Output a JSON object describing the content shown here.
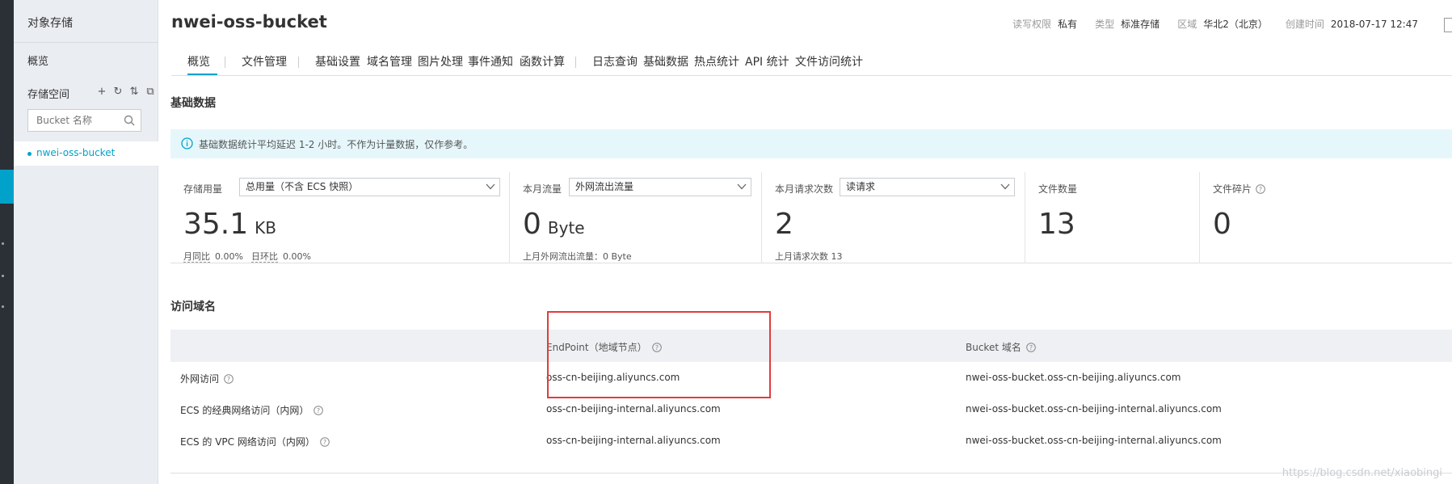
{
  "sidebar": {
    "title": "对象存储",
    "overview": "概览",
    "space_label": "存储空间",
    "tools": [
      "+",
      "↻",
      "⇅",
      "⧉"
    ],
    "search_placeholder": "Bucket 名称",
    "bucket_name": "nwei-oss-bucket"
  },
  "header": {
    "title": "nwei-oss-bucket",
    "meta": [
      {
        "k": "读写权限",
        "v": "私有"
      },
      {
        "k": "类型",
        "v": "标准存储"
      },
      {
        "k": "区域",
        "v": "华北2（北京）"
      },
      {
        "k": "创建时间",
        "v": "2018-07-17 12:47"
      }
    ]
  },
  "tabs": [
    "概览",
    "文件管理",
    "基础设置",
    "域名管理",
    "图片处理",
    "事件通知",
    "函数计算",
    "日志查询",
    "基础数据",
    "热点统计",
    "API 统计",
    "文件访问统计"
  ],
  "basic_data": {
    "title": "基础数据",
    "notice": "基础数据统计平均延迟 1-2 小时。不作为计量数据，仅作参考。",
    "stats": [
      {
        "label": "存储用量",
        "select": "总用量（不含 ECS 快照）",
        "value": "35.1",
        "unit": "KB",
        "sub1_k": "月同比",
        "sub1_v": "0.00%",
        "sub2_k": "日环比",
        "sub2_v": "0.00%"
      },
      {
        "label": "本月流量",
        "select": "外网流出流量",
        "value": "0",
        "unit": "Byte",
        "sub": "上月外网流出流量：0 Byte"
      },
      {
        "label": "本月请求次数",
        "select": "读请求",
        "value": "2",
        "unit": "",
        "sub": "上月请求次数 13"
      },
      {
        "label": "文件数量",
        "value": "13"
      },
      {
        "label": "文件碎片",
        "value": "0"
      }
    ]
  },
  "domains": {
    "title": "访问域名",
    "headers": [
      "",
      "EndPoint（地域节点）",
      "Bucket 域名"
    ],
    "rows": [
      {
        "type": "外网访问",
        "endpoint": "oss-cn-beijing.aliyuncs.com",
        "domain": "nwei-oss-bucket.oss-cn-beijing.aliyuncs.com"
      },
      {
        "type": "ECS 的经典网络访问（内网）",
        "endpoint": "oss-cn-beijing-internal.aliyuncs.com",
        "domain": "nwei-oss-bucket.oss-cn-beijing-internal.aliyuncs.com"
      },
      {
        "type": "ECS 的 VPC 网络访问（内网）",
        "endpoint": "oss-cn-beijing-internal.aliyuncs.com",
        "domain": "nwei-oss-bucket.oss-cn-beijing-internal.aliyuncs.com"
      }
    ]
  },
  "watermark": "https://blog.csdn.net/xiaobingi"
}
